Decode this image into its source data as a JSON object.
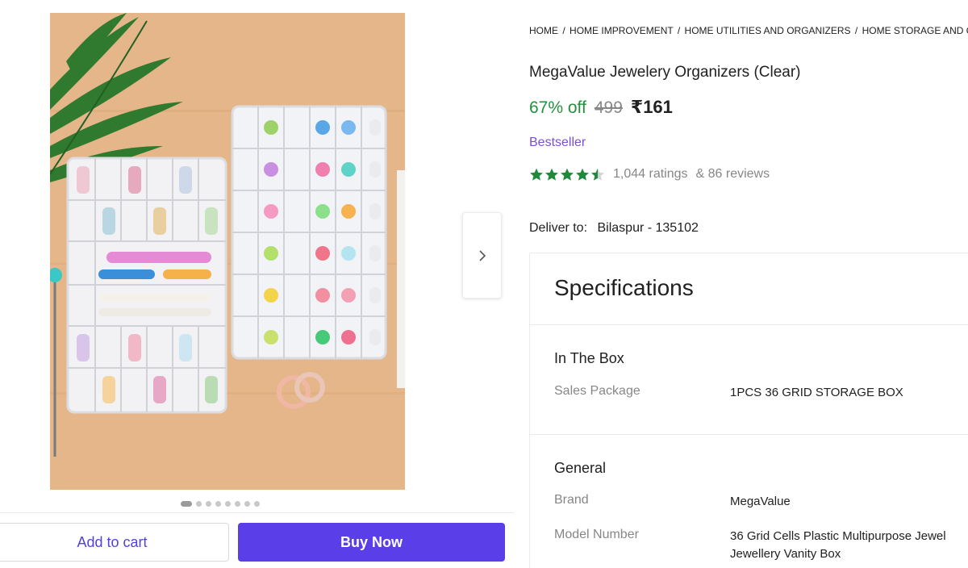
{
  "gallery": {
    "image_alt": "MegaValue Jewelery Organizers product photo",
    "slide_count": 8,
    "active_slide": 1
  },
  "actions": {
    "add_to_cart": "Add to cart",
    "buy_now": "Buy Now"
  },
  "breadcrumb": [
    "HOME",
    "HOME IMPROVEMENT",
    "HOME UTILITIES AND ORGANIZERS",
    "HOME STORAGE AND O"
  ],
  "product": {
    "title": "MegaValue Jewelery Organizers (Clear)",
    "discount": "67% off",
    "mrp": "499",
    "price": "₹161",
    "badge": "Bestseller",
    "rating_value": 4.5,
    "ratings_text": "1,044 ratings",
    "reviews_text": "& 86 reviews"
  },
  "delivery": {
    "label": "Deliver to:",
    "location": "Bilaspur - 135102"
  },
  "specifications": {
    "title": "Specifications",
    "sections": [
      {
        "heading": "In The Box",
        "rows": [
          {
            "key": "Sales Package",
            "value": "1PCS 36 GRID STORAGE BOX"
          }
        ]
      },
      {
        "heading": "General",
        "rows": [
          {
            "key": "Brand",
            "value": "MegaValue"
          },
          {
            "key": "Model Number",
            "value": "36 Grid Cells Plastic Multipurpose Jewel",
            "value2": "Jewellery Vanity Box"
          }
        ]
      }
    ]
  },
  "colors": {
    "accent": "#5a3ee8",
    "discount_green": "#23903d",
    "star_green": "#1f8a3b",
    "bestseller_purple": "#7a4fd8"
  }
}
